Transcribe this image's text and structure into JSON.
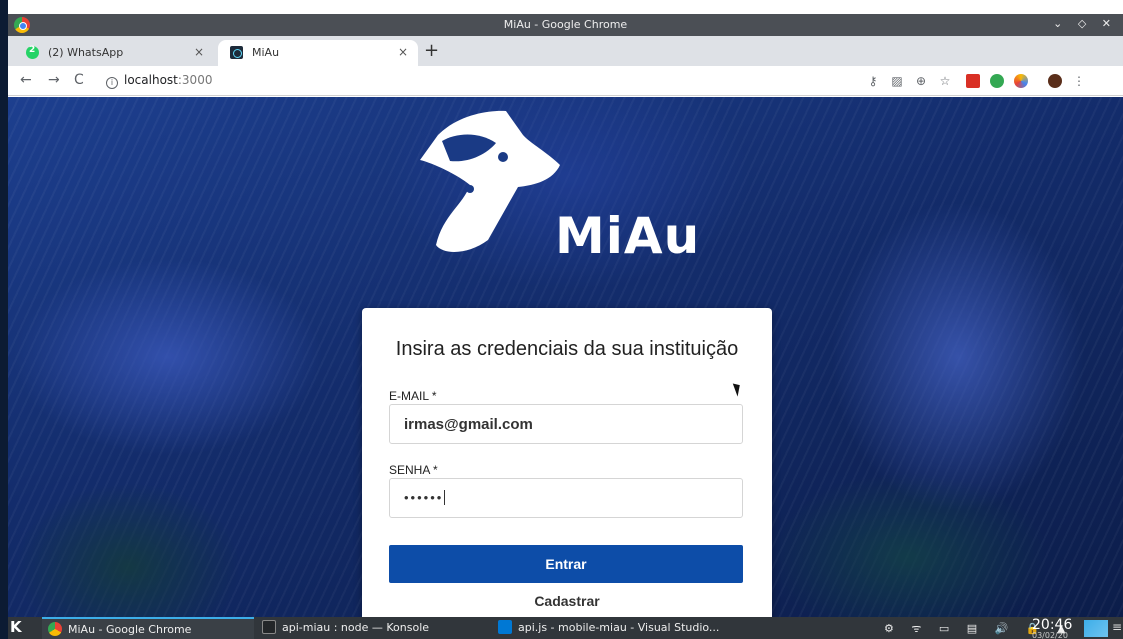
{
  "window": {
    "title": "MiAu - Google Chrome",
    "controls": "⌄ ◇ ✕"
  },
  "browser": {
    "tabs": [
      {
        "label": "(2) WhatsApp",
        "active": false,
        "icon": "whatsapp-icon"
      },
      {
        "label": "MiAu",
        "active": true,
        "icon": "react-icon"
      }
    ],
    "tab_close": "×",
    "new_tab": "+",
    "nav": {
      "back": "←",
      "forward": "→",
      "reload": "C"
    },
    "url_info": "i",
    "url_host": "localhost",
    "url_port": ":3000",
    "extension_icons": [
      "key-icon",
      "translate-icon",
      "zoom-icon",
      "bookmark-star-icon",
      "ext-red-icon",
      "ext-green-icon",
      "ext-colorful-icon",
      "profile-avatar-icon",
      "menu-dots-icon"
    ]
  },
  "page": {
    "logo_text": "MiAu",
    "card_title": "Insira as credenciais da sua instituição",
    "email_label": "E-MAIL *",
    "email_value": "irmas@gmail.com",
    "password_label": "SENHA *",
    "password_value": "••••••",
    "submit_label": "Entrar",
    "register_label": "Cadastrar",
    "accent_color": "#0d4da8"
  },
  "taskbar": {
    "start_label": "K",
    "tasks": [
      {
        "label": "MiAu - Google Chrome",
        "icon": "chrome-icon",
        "active": true
      },
      {
        "label": "api-miau : node — Konsole",
        "icon": "konsole-icon",
        "active": false
      },
      {
        "label": "api.js - mobile-miau - Visual Studio...",
        "icon": "vscode-icon",
        "active": false
      }
    ],
    "tray": "⚙ ᯤ ▭ ▤ 🔊 🔒 ▲",
    "clock": "20:46",
    "date": "03/02/20"
  }
}
